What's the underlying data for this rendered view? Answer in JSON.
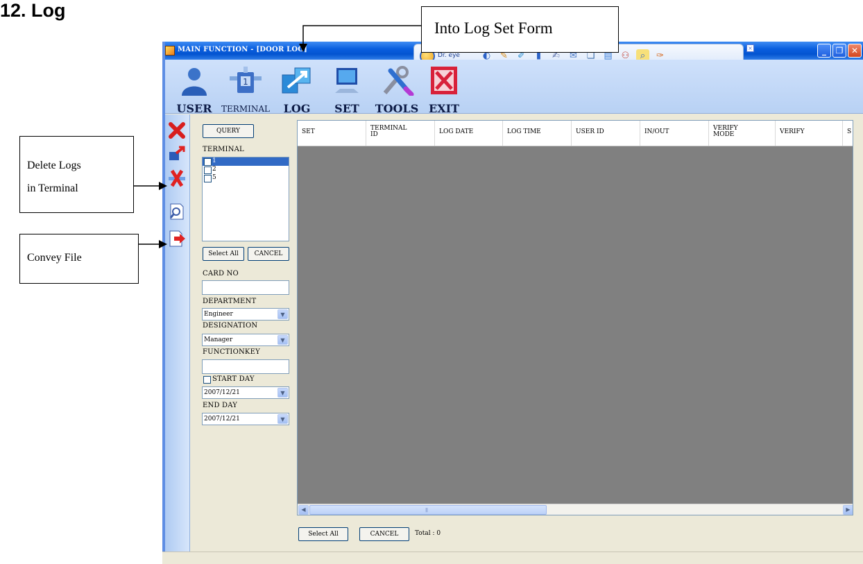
{
  "document": {
    "heading": "12. Log",
    "callouts": {
      "into_log_set": "Into Log Set Form",
      "delete_logs_line1": "Delete Logs",
      "delete_logs_line2": "in Terminal",
      "convey_file": "Convey File"
    }
  },
  "window": {
    "title": "MAIN FUNCTION - [DOOR LOG]",
    "buttons": [
      "minimize",
      "restore",
      "close"
    ]
  },
  "drEye": {
    "label": "Dr. eye",
    "close": "×"
  },
  "toolbar": {
    "items": [
      {
        "label": "USER",
        "icon": "user-icon"
      },
      {
        "label": "TERMINAL",
        "icon": "terminal-icon"
      },
      {
        "label": "LOG",
        "icon": "log-icon"
      },
      {
        "label": "SET",
        "icon": "set-icon"
      },
      {
        "label": "TOOLS",
        "icon": "tools-icon"
      },
      {
        "label": "EXIT",
        "icon": "exit-icon"
      }
    ]
  },
  "sideIcons": [
    "delete-icon",
    "download-icon",
    "delete-logs-in-terminal-icon",
    "search-document-icon",
    "convey-file-icon"
  ],
  "filter": {
    "query_button": "QUERY",
    "terminal_label": "TERMINAL",
    "terminals": [
      "1",
      "2",
      "5"
    ],
    "select_all": "Select All",
    "cancel": "CANCEL",
    "card_no_label": "CARD NO",
    "card_no_value": "",
    "department_label": "DEPARTMENT",
    "department_value": "Engineer",
    "designation_label": "DESIGNATION",
    "designation_value": "Manager",
    "functionkey_label": "FUNCTIONKEY",
    "functionkey_value": "",
    "start_day_label": "START DAY",
    "start_day_value": "2007/12/21",
    "end_day_label": "END DAY",
    "end_day_value": "2007/12/21"
  },
  "grid": {
    "columns": [
      {
        "line1": "SET",
        "line2": ""
      },
      {
        "line1": "TERMINAL",
        "line2": "ID"
      },
      {
        "line1": "LOG DATE",
        "line2": ""
      },
      {
        "line1": "LOG TIME",
        "line2": ""
      },
      {
        "line1": "USER ID",
        "line2": ""
      },
      {
        "line1": "IN/OUT",
        "line2": ""
      },
      {
        "line1": "VERIFY",
        "line2": "MODE"
      },
      {
        "line1": "VERIFY",
        "line2": ""
      },
      {
        "line1": "S",
        "line2": ""
      }
    ],
    "rows": []
  },
  "footer": {
    "select_all": "Select All",
    "cancel": "CANCEL",
    "total": "Total : 0"
  },
  "colors": {
    "titlebar": "#0a5fdf",
    "toolbar": "#c4d9f6",
    "grid_bg": "#808080",
    "selection": "#316ac5",
    "panel_bg": "#ece9d8"
  }
}
